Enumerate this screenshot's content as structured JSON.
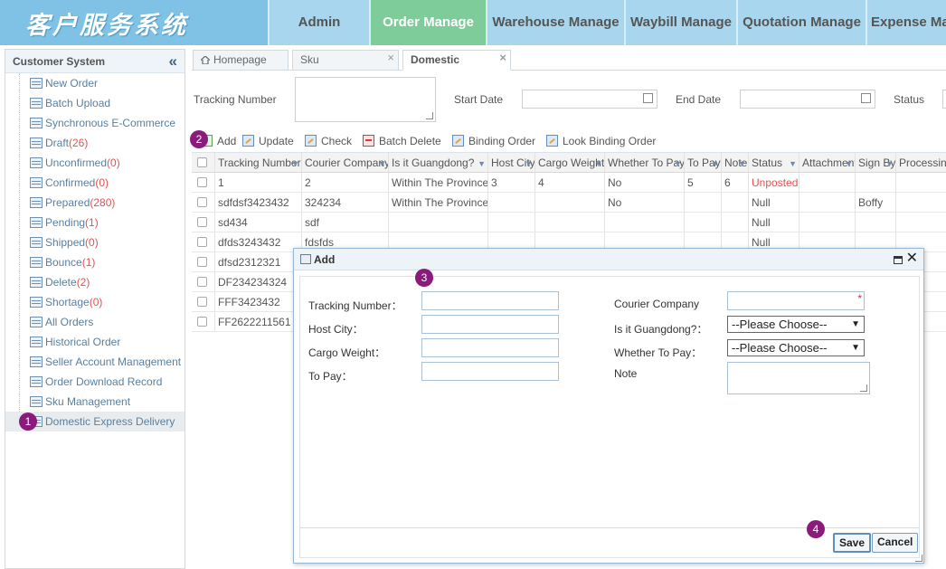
{
  "header": {
    "logo": "客户服务系统",
    "nav": [
      "Admin",
      "Order Manage",
      "Warehouse Manage",
      "Waybill Manage",
      "Quotation Manage",
      "Expense Ma"
    ],
    "active_nav": 1
  },
  "sidebar": {
    "title": "Customer System",
    "items": [
      {
        "label": "New Order",
        "count": ""
      },
      {
        "label": "Batch Upload",
        "count": ""
      },
      {
        "label": "Synchronous E-Commerce",
        "count": ""
      },
      {
        "label": "Draft",
        "count": "(26)"
      },
      {
        "label": "Unconfirmed",
        "count": "(0)"
      },
      {
        "label": "Confirmed",
        "count": "(0)"
      },
      {
        "label": "Prepared",
        "count": "(280)"
      },
      {
        "label": "Pending",
        "count": "(1)"
      },
      {
        "label": "Shipped",
        "count": "(0)"
      },
      {
        "label": "Bounce",
        "count": "(1)"
      },
      {
        "label": "Delete",
        "count": "(2)"
      },
      {
        "label": "Shortage",
        "count": "(0)"
      },
      {
        "label": "All Orders",
        "count": ""
      },
      {
        "label": "Historical Order",
        "count": ""
      },
      {
        "label": "Seller Account Management",
        "count": ""
      },
      {
        "label": "Order Download Record",
        "count": ""
      },
      {
        "label": "Sku Management",
        "count": ""
      },
      {
        "label": "Domestic Express Delivery",
        "count": ""
      }
    ],
    "active_index": 17
  },
  "badges": {
    "b1": "1",
    "b2": "2",
    "b3": "3",
    "b4": "4"
  },
  "tabs": {
    "homepage": "Homepage",
    "sku": "Sku",
    "domestic": "Domestic",
    "close": "×"
  },
  "search": {
    "tracking_label": "Tracking Number",
    "start_label": "Start Date",
    "end_label": "End Date",
    "status_label": "Status"
  },
  "toolbar": {
    "add": "Add",
    "update": "Update",
    "check": "Check",
    "batch_delete": "Batch Delete",
    "binding_order": "Binding Order",
    "look_binding_order": "Look Binding Order"
  },
  "grid": {
    "headers": [
      "Tracking Number",
      "Courier Company",
      "Is it Guangdong?",
      "Host City",
      "Cargo Weight",
      "Whether To Pay",
      "To Pay",
      "Note",
      "Status",
      "Attachment",
      "Sign By",
      "Processing"
    ],
    "rows": [
      [
        "1",
        "2",
        "Within The Province",
        "3",
        "4",
        "No",
        "5",
        "6",
        "Unposted",
        "",
        "",
        ""
      ],
      [
        "sdfdsf3423432",
        "324234",
        "Within The Province",
        "",
        "",
        "No",
        "",
        "",
        "Null",
        "",
        "Boffy",
        ""
      ],
      [
        "sd434",
        "sdf",
        "",
        "",
        "",
        "",
        "",
        "",
        "Null",
        "",
        "",
        ""
      ],
      [
        "dfds3243432",
        "fdsfds",
        "",
        "",
        "",
        "",
        "",
        "",
        "Null",
        "",
        "",
        ""
      ],
      [
        "dfsd2312321",
        "",
        "",
        "",
        "",
        "",
        "",
        "",
        "",
        "",
        "",
        ""
      ],
      [
        "DF234234324",
        "",
        "",
        "",
        "",
        "",
        "",
        "",
        "",
        "",
        "",
        ""
      ],
      [
        "FFF3423432",
        "",
        "",
        "",
        "",
        "",
        "",
        "",
        "",
        "",
        "",
        ""
      ],
      [
        "FF2622211561",
        "",
        "",
        "",
        "",
        "",
        "",
        "",
        "",
        "",
        "",
        ""
      ]
    ]
  },
  "dialog": {
    "title": "Add",
    "tracking_number": "Tracking Number：",
    "host_city": "Host City：",
    "cargo_weight": "Cargo Weight：",
    "to_pay": "To Pay：",
    "courier_company": "Courier Company",
    "is_guangdong": "Is it Guangdong?：",
    "whether_to_pay": "Whether To Pay：",
    "note": "Note",
    "please_choose": "--Please Choose--",
    "required_mark": "*",
    "save": "Save",
    "cancel": "Cancel"
  },
  "colors": {
    "accent_nav": "#7dcc99",
    "header": "#a8d6ee",
    "count_red": "#e35252",
    "badge": "#8a1a7c"
  }
}
